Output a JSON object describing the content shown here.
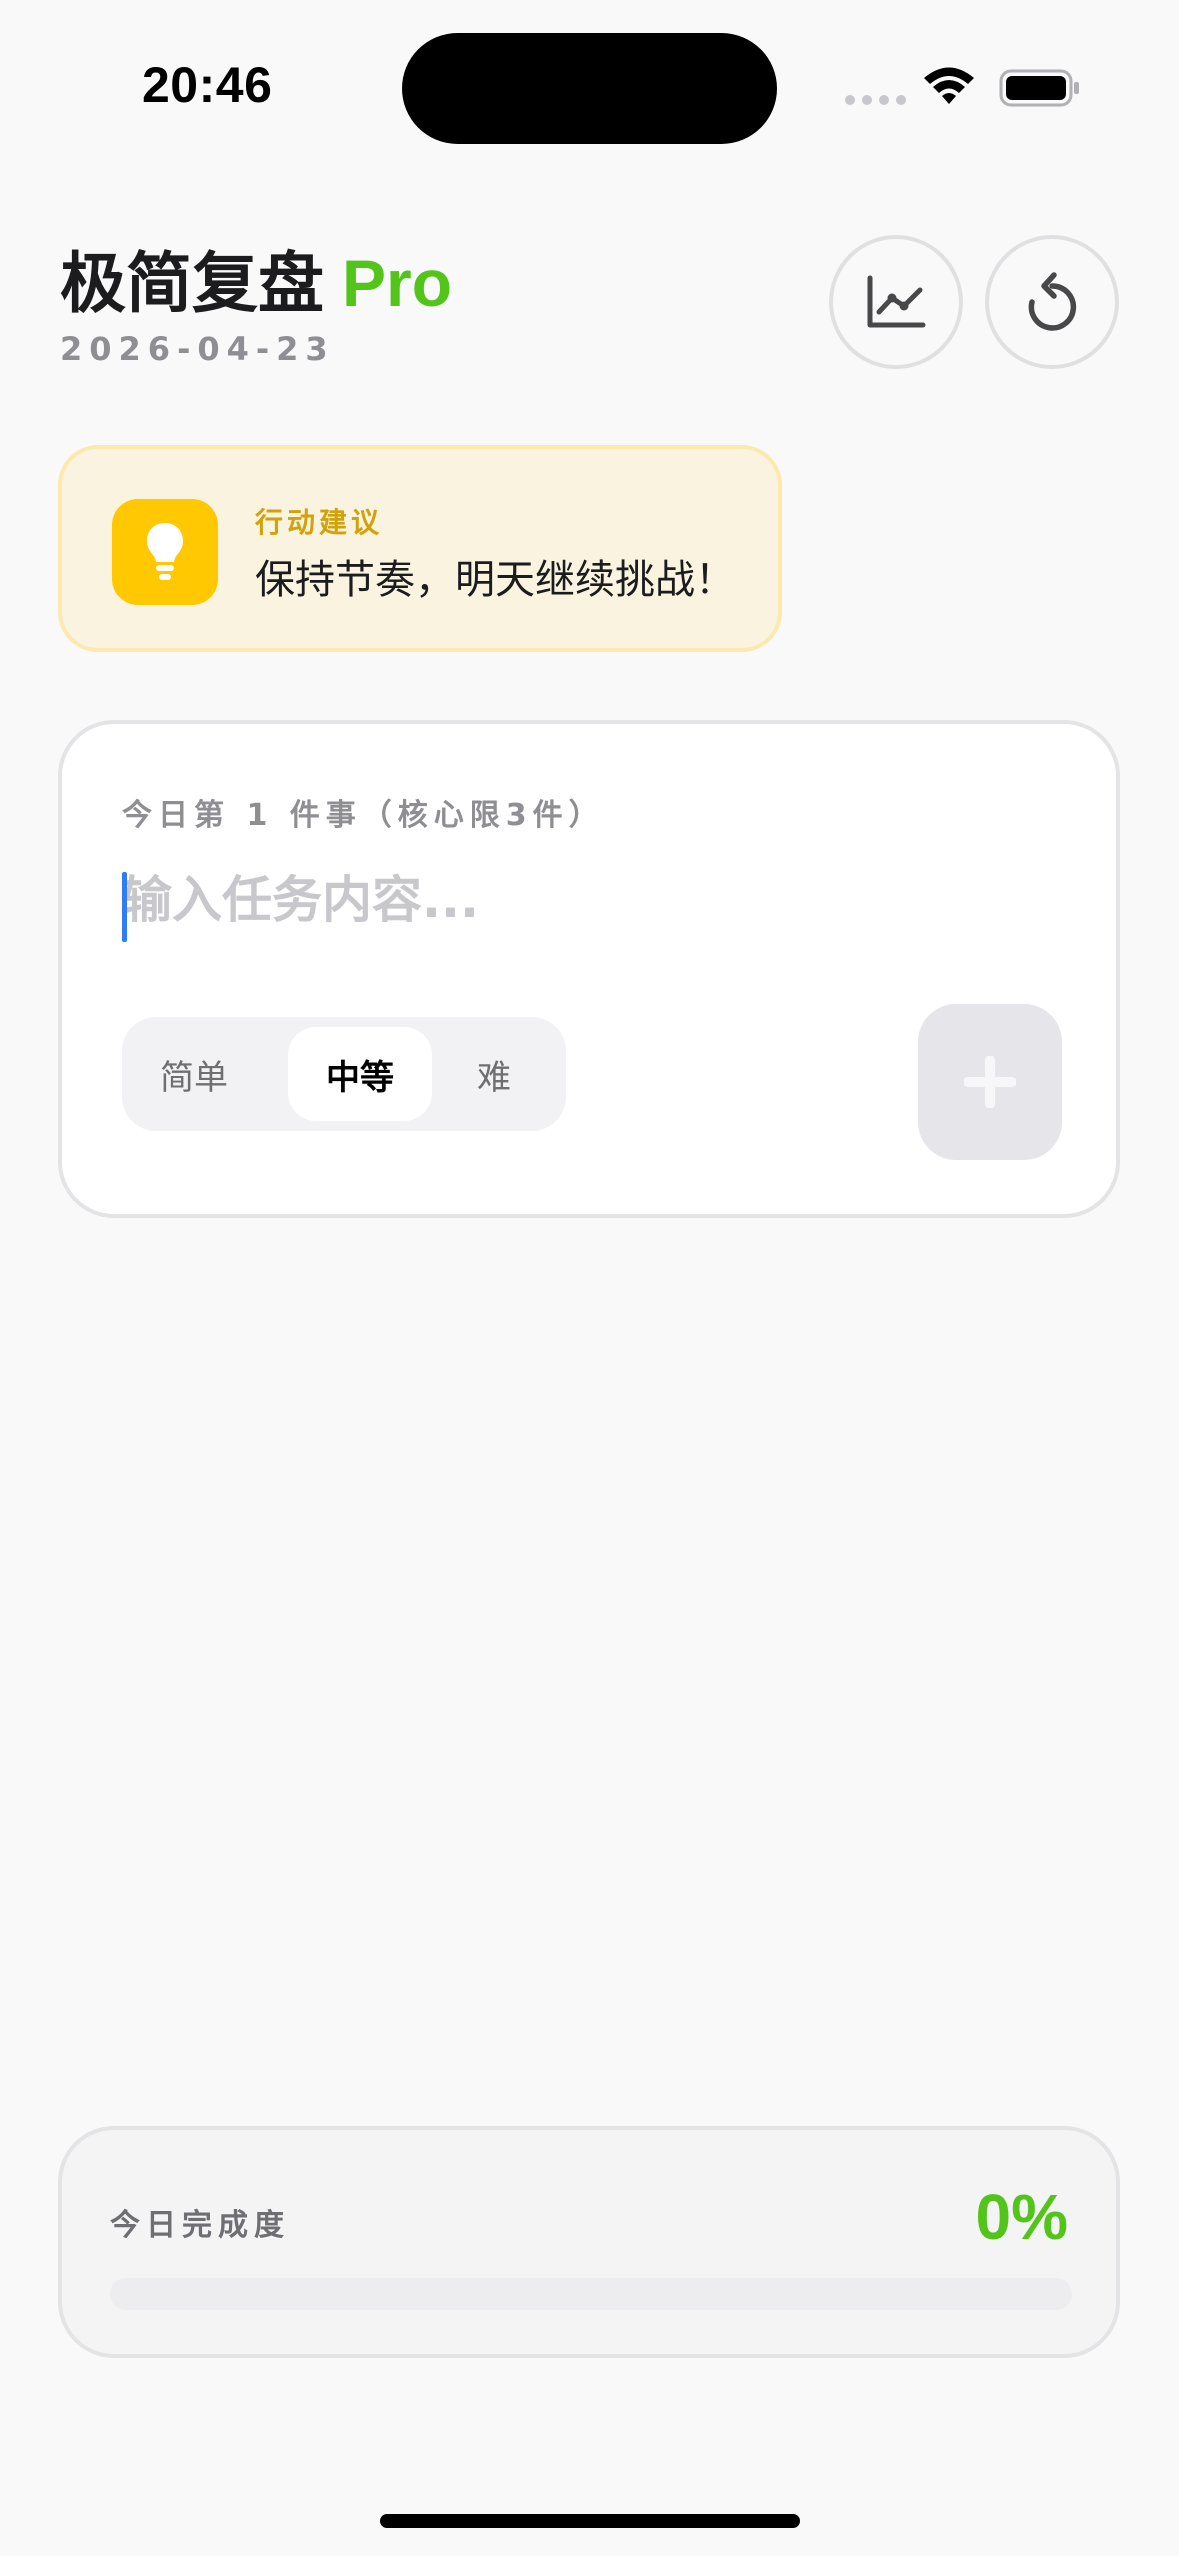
{
  "status_bar": {
    "time": "20:46",
    "icons": [
      "cellular-signal-icon",
      "wifi-icon",
      "battery-icon"
    ]
  },
  "header": {
    "title": "极简复盘",
    "badge": "Pro",
    "date": "2026-04-23",
    "buttons": [
      {
        "name": "stats-button",
        "icon": "line-chart-icon"
      },
      {
        "name": "reset-button",
        "icon": "rotate-ccw-icon"
      }
    ]
  },
  "advice": {
    "icon": "lightbulb-icon",
    "label": "行动建议",
    "text": "保持节奏，明天继续挑战！"
  },
  "task_form": {
    "label": "今日第 1 件事（核心限3件）",
    "input_value": "",
    "input_placeholder": "输入任务内容...",
    "difficulty_options": [
      "简单",
      "中等",
      "难"
    ],
    "selected_difficulty": "中等",
    "add_icon": "plus-icon"
  },
  "progress": {
    "label": "今日完成度",
    "value_text": "0%",
    "fraction": 0
  },
  "colors": {
    "accent_green": "#52c41a",
    "advice_yellow": "#ffc800",
    "advice_bg": "#f9f3df",
    "caret_blue": "#2f7cf6",
    "background": "#f9f9f9"
  }
}
